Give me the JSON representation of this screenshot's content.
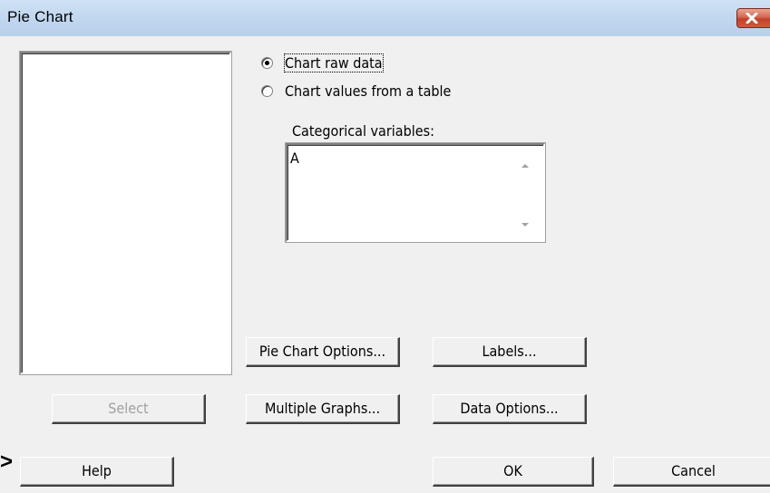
{
  "window": {
    "title": "Pie Chart"
  },
  "source": {
    "options": [
      {
        "label": "Chart raw data",
        "selected": true
      },
      {
        "label": "Chart values from a table",
        "selected": false
      }
    ]
  },
  "categorical": {
    "label": "Categorical variables:",
    "value": "A"
  },
  "buttons": {
    "pie_chart_options": "Pie Chart Options...",
    "labels": "Labels...",
    "multiple_graphs": "Multiple Graphs...",
    "data_options": "Data Options...",
    "select": "Select",
    "help": "Help",
    "ok": "OK",
    "cancel": "Cancel"
  },
  "colors": {
    "titlebar": "#c0d6ef",
    "close_button": "#c2412a",
    "dialog_face": "#f0f0f0"
  },
  "icons": {
    "close": "close-icon",
    "radio": "radio-button-icon",
    "scroll_up": "scroll-up-arrow-icon",
    "scroll_down": "scroll-down-arrow-icon"
  }
}
